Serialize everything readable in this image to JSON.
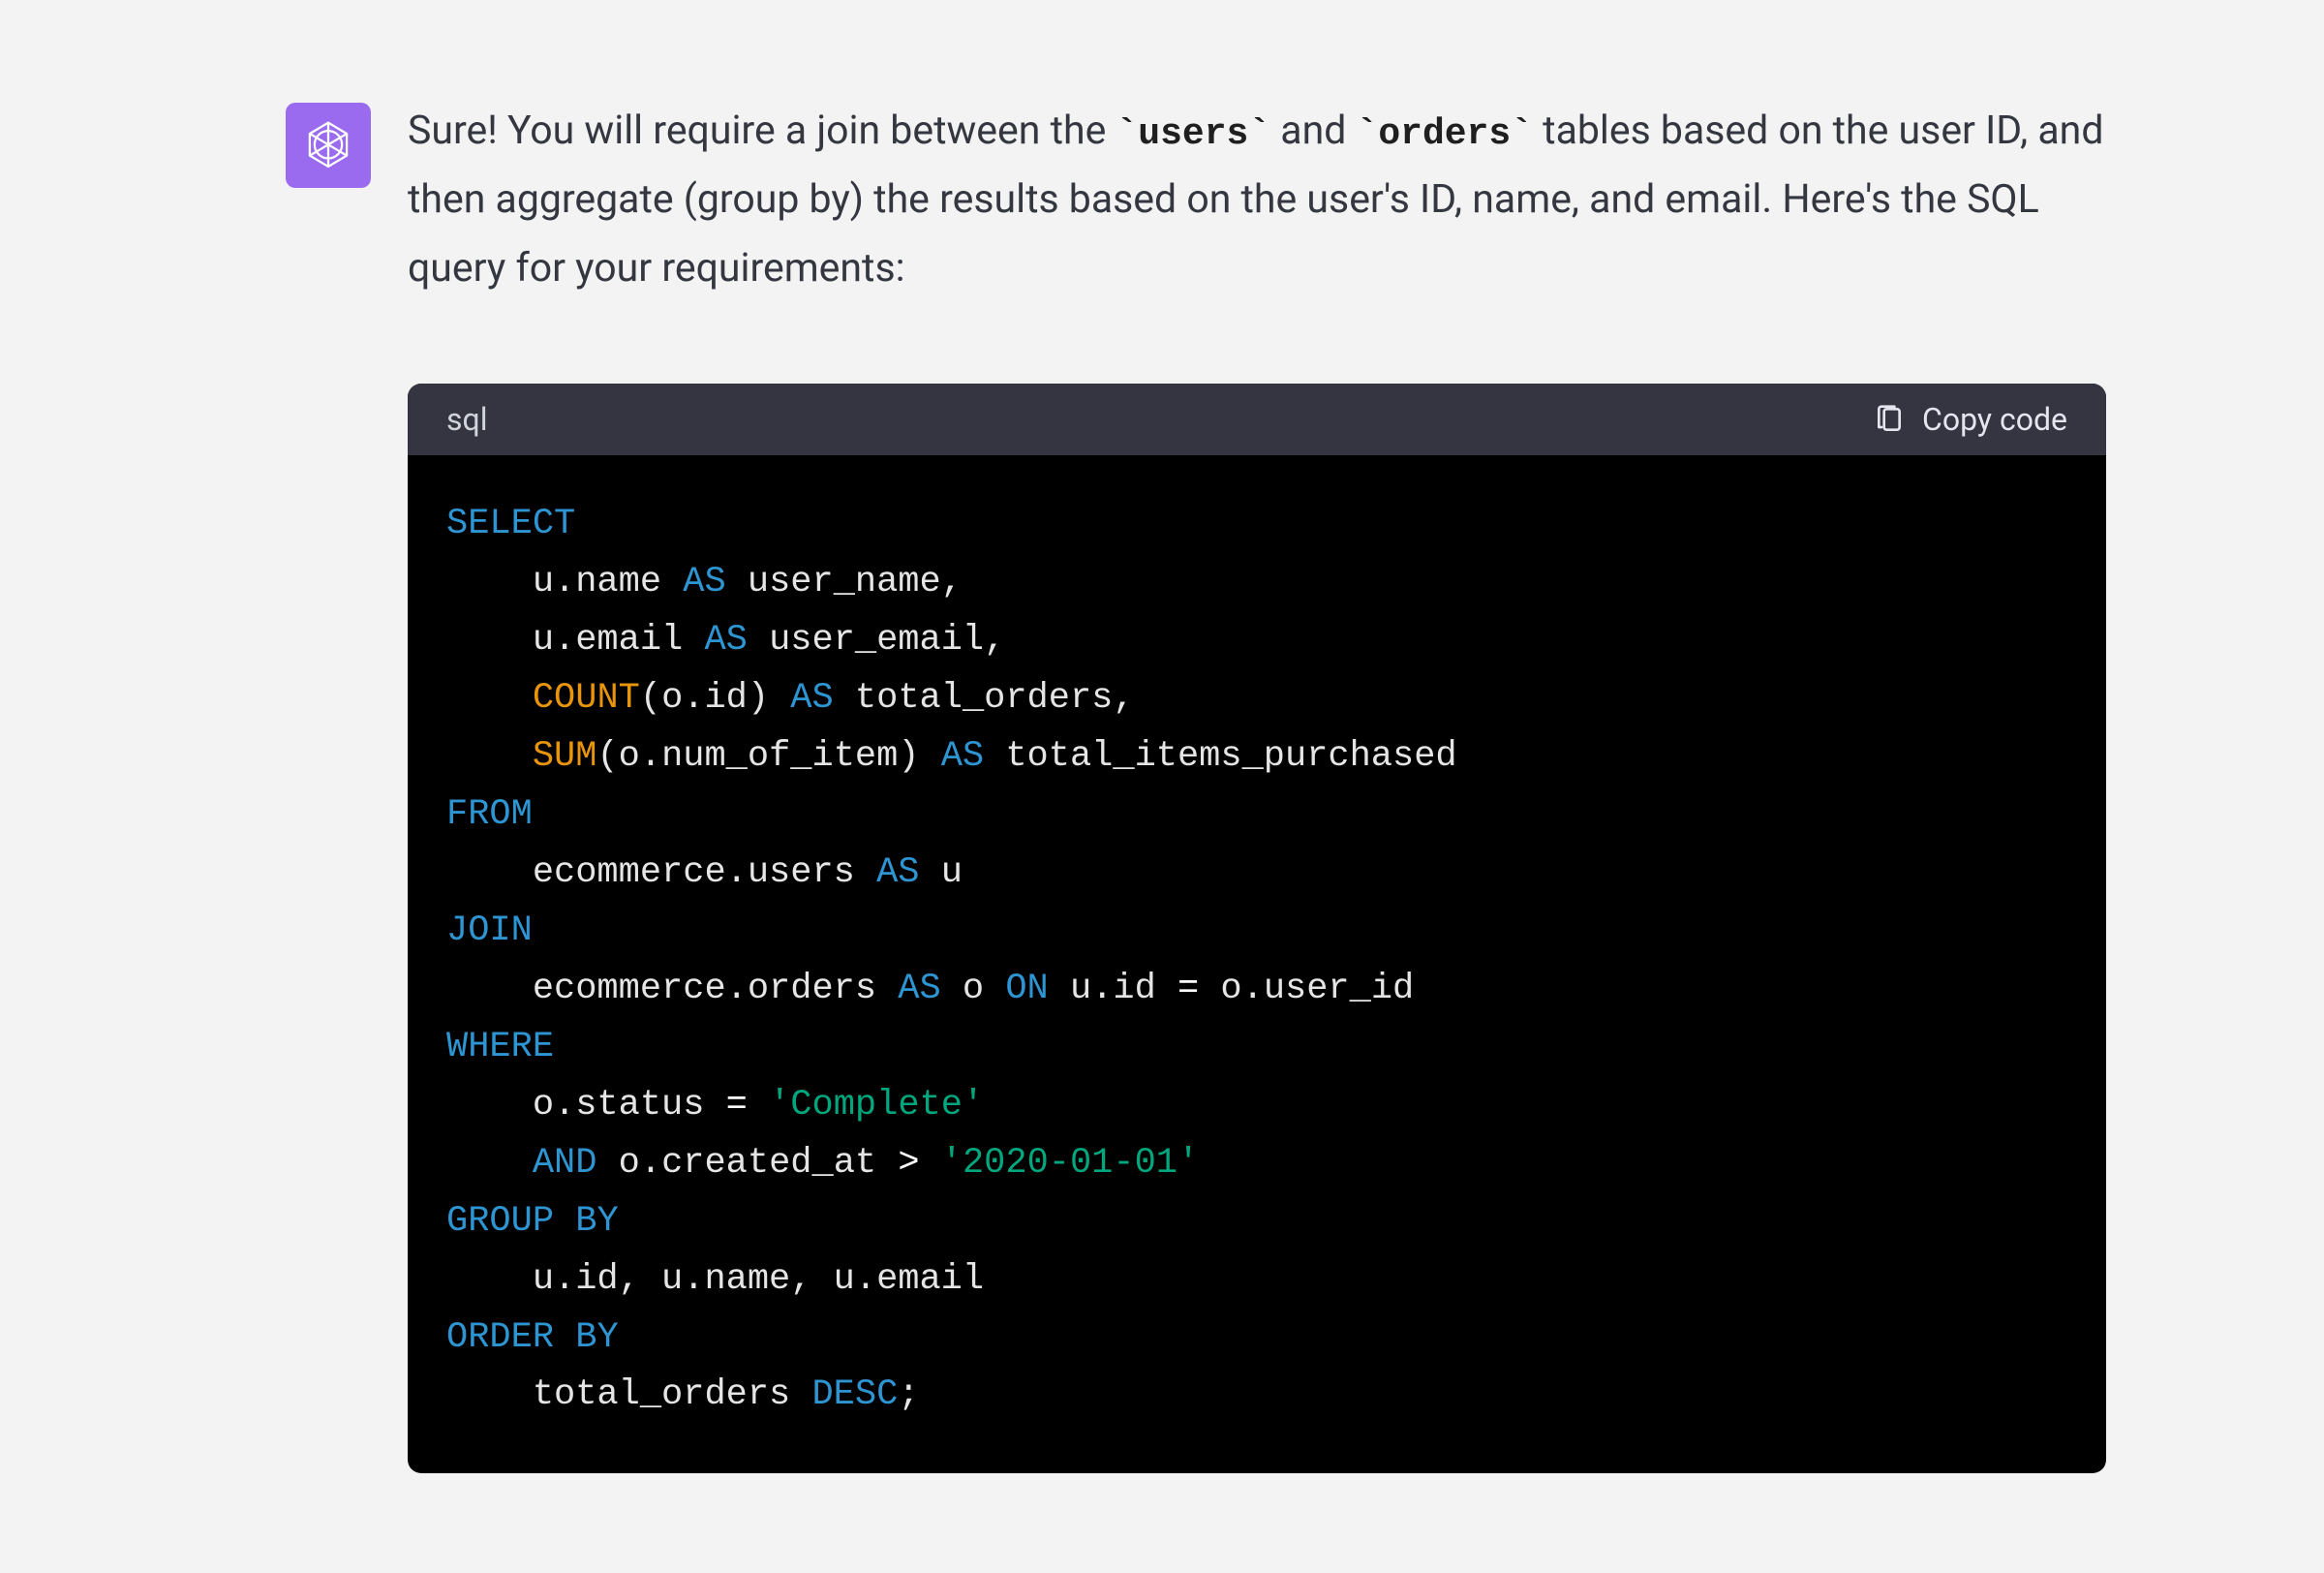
{
  "avatar": "openai-logo",
  "message": {
    "pre1": "Sure! You will require a join between the ",
    "code1": "`users`",
    "mid1": " and ",
    "code2": "`orders`",
    "post1": " tables based on the user ID, and then aggregate (group by) the results based on the user's ID, name, and email. Here's the SQL query for your requirements:"
  },
  "codeblock": {
    "language": "sql",
    "copy_label": "Copy code",
    "tokens": [
      [
        [
          "kw",
          "SELECT"
        ]
      ],
      [
        [
          "pl",
          "    u.name "
        ],
        [
          "kw",
          "AS"
        ],
        [
          "pl",
          " user_name,"
        ]
      ],
      [
        [
          "pl",
          "    u.email "
        ],
        [
          "kw",
          "AS"
        ],
        [
          "pl",
          " user_email,"
        ]
      ],
      [
        [
          "pl",
          "    "
        ],
        [
          "fn",
          "COUNT"
        ],
        [
          "pl",
          "(o.id) "
        ],
        [
          "kw",
          "AS"
        ],
        [
          "pl",
          " total_orders,"
        ]
      ],
      [
        [
          "pl",
          "    "
        ],
        [
          "fn",
          "SUM"
        ],
        [
          "pl",
          "(o.num_of_item) "
        ],
        [
          "kw",
          "AS"
        ],
        [
          "pl",
          " total_items_purchased"
        ]
      ],
      [
        [
          "kw",
          "FROM"
        ]
      ],
      [
        [
          "pl",
          "    ecommerce.users "
        ],
        [
          "kw",
          "AS"
        ],
        [
          "pl",
          " u"
        ]
      ],
      [
        [
          "kw",
          "JOIN"
        ]
      ],
      [
        [
          "pl",
          "    ecommerce.orders "
        ],
        [
          "kw",
          "AS"
        ],
        [
          "pl",
          " o "
        ],
        [
          "kw",
          "ON"
        ],
        [
          "pl",
          " u.id "
        ],
        [
          "op",
          "="
        ],
        [
          "pl",
          " o.user_id"
        ]
      ],
      [
        [
          "kw",
          "WHERE"
        ]
      ],
      [
        [
          "pl",
          "    o.status "
        ],
        [
          "op",
          "="
        ],
        [
          "pl",
          " "
        ],
        [
          "str",
          "'Complete'"
        ]
      ],
      [
        [
          "pl",
          "    "
        ],
        [
          "kw",
          "AND"
        ],
        [
          "pl",
          " o.created_at "
        ],
        [
          "op",
          ">"
        ],
        [
          "pl",
          " "
        ],
        [
          "str",
          "'2020-01-01'"
        ]
      ],
      [
        [
          "kw",
          "GROUP"
        ],
        [
          "pl",
          " "
        ],
        [
          "kw",
          "BY"
        ]
      ],
      [
        [
          "pl",
          "    u.id, u.name, u.email"
        ]
      ],
      [
        [
          "kw",
          "ORDER"
        ],
        [
          "pl",
          " "
        ],
        [
          "kw",
          "BY"
        ]
      ],
      [
        [
          "pl",
          "    total_orders "
        ],
        [
          "kw",
          "DESC"
        ],
        [
          "pl",
          ";"
        ]
      ]
    ]
  }
}
